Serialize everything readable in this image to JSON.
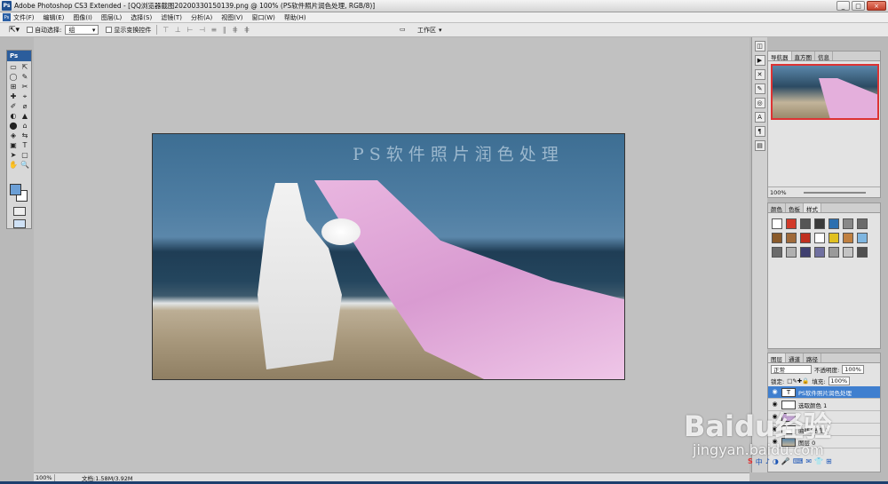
{
  "window": {
    "title": "Adobe Photoshop CS3 Extended - [QQ浏览器截图20200330150139.png @ 100% (PS软件照片润色处理, RGB/8)]",
    "app_icon": "Ps",
    "buttons": {
      "minimize": "_",
      "maximize": "□",
      "close": "×"
    }
  },
  "menu": {
    "icon": "Ps",
    "items": [
      "文件(F)",
      "编辑(E)",
      "图像(I)",
      "图层(L)",
      "选择(S)",
      "滤镜(T)",
      "分析(A)",
      "视图(V)",
      "窗口(W)",
      "帮助(H)"
    ]
  },
  "options": {
    "auto_select_label": "自动选择:",
    "auto_select_value": "组",
    "show_transform_label": "显示变换控件",
    "align_glyphs": "⊤ ⊥ ⊢ ⊣ ≡ ∥ ⋕ ⋕",
    "workspace_label": "工作区"
  },
  "toolbox": {
    "title": "Ps",
    "tools": [
      "▭",
      "⇱",
      "◯",
      "✎",
      "⊞",
      "✂",
      "✚",
      "⌖",
      "✐",
      "⌀",
      "◐",
      "▲",
      "⬤",
      "⌂",
      "◈",
      "⇆",
      "▣",
      "T",
      "➤",
      "▢",
      "✋",
      "🔍"
    ]
  },
  "document": {
    "watermark": "PS软件照片润色处理"
  },
  "navigator": {
    "tabs": [
      "导航器",
      "直方图",
      "信息"
    ],
    "zoom": "100%"
  },
  "swatches_panel": {
    "tabs": [
      "颜色",
      "色板",
      "样式"
    ],
    "colors": [
      "#ffffff",
      "#d23a2a",
      "#555555",
      "#3a3a3a",
      "#2c6fb0",
      "#888888",
      "#6a6a6a",
      "#8a5a2a",
      "#a06a3a",
      "#c03020",
      "#ffffff",
      "#e0c020",
      "#c08040",
      "#7fb6e0",
      "#6b6b6b",
      "#b0b0b0",
      "#404070",
      "#7070a0",
      "#9a9a9a",
      "#c4c4c4",
      "#505050"
    ]
  },
  "layers": {
    "tabs": [
      "图层",
      "通道",
      "路径"
    ],
    "blend_mode": "正常",
    "opacity_label": "不透明度:",
    "opacity": "100%",
    "lock_label": "锁定:",
    "fill_label": "填充:",
    "fill": "100%",
    "rows": [
      {
        "name": "PS软件照片润色处理",
        "type": "T"
      },
      {
        "name": "选取颜色 1",
        "type": ""
      },
      {
        "name": "",
        "type": ""
      },
      {
        "name": "曲线/亮度 1",
        "type": ""
      },
      {
        "name": "图层 0",
        "type": ""
      }
    ]
  },
  "status": {
    "zoom": "100%",
    "doc": "文档:1.58M/3.92M"
  },
  "overlay": {
    "baidu": "Baidu经验",
    "url": "jingyan.baidu.com",
    "ime": [
      "S",
      "中",
      "♪",
      "◑",
      "🎤",
      "⌨",
      "✉",
      "👕",
      "⊞"
    ]
  }
}
